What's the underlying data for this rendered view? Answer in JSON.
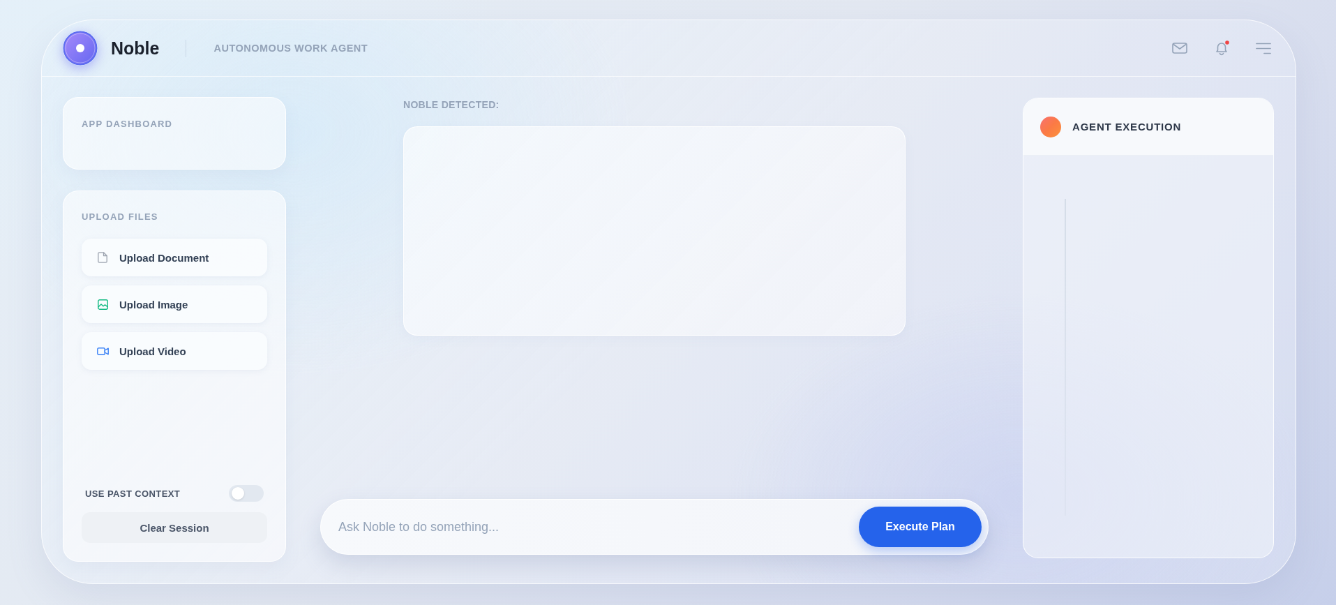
{
  "header": {
    "app_name": "Noble",
    "subtitle": "AUTONOMOUS WORK AGENT",
    "has_unread_notifications": true
  },
  "sidebar": {
    "dashboard": {
      "title": "APP DASHBOARD"
    },
    "uploads": {
      "title": "UPLOAD FILES",
      "items": [
        {
          "kind": "document",
          "label": "Upload Document"
        },
        {
          "kind": "image",
          "label": "Upload Image"
        },
        {
          "kind": "video",
          "label": "Upload Video"
        }
      ]
    },
    "context_toggle": {
      "label": "USE PAST CONTEXT",
      "on": false
    },
    "clear_button": "Clear Session"
  },
  "main": {
    "detected_label": "NOBLE DETECTED:",
    "prompt": {
      "placeholder": "Ask Noble to do something...",
      "button": "Execute Plan"
    }
  },
  "execution_panel": {
    "title": "AGENT EXECUTION"
  }
}
